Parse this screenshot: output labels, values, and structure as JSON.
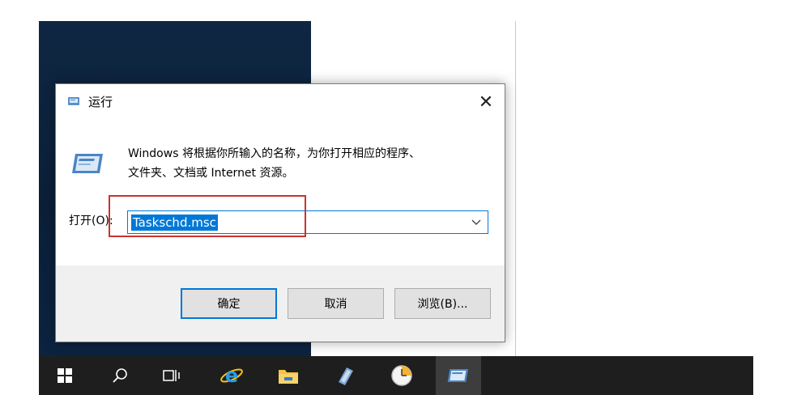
{
  "dialog": {
    "title": "运行",
    "description_line1": "Windows 将根据你所输入的名称，为你打开相应的程序、",
    "description_line2": "文件夹、文档或 Internet 资源。",
    "open_label": "打开(O):",
    "open_value": "Taskschd.msc",
    "buttons": {
      "ok": "确定",
      "cancel": "取消",
      "browse": "浏览(B)..."
    }
  },
  "taskbar": {
    "items": [
      "start-icon",
      "search-icon",
      "task-view-icon",
      "internet-explorer-icon",
      "file-explorer-icon",
      "server-manager-icon",
      "clock-icon",
      "run-icon"
    ]
  },
  "colors": {
    "accent": "#0078d7",
    "highlight": "#c8342e",
    "taskbar": "#1e1e1e",
    "desktop": "#0f2742"
  }
}
